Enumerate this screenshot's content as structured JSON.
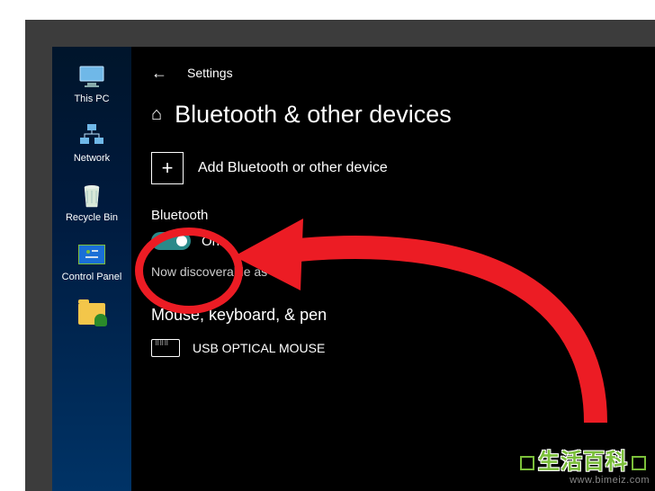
{
  "desktop": {
    "icons": [
      {
        "name": "this-pc",
        "label": "This PC"
      },
      {
        "name": "network",
        "label": "Network"
      },
      {
        "name": "recycle-bin",
        "label": "Recycle Bin"
      },
      {
        "name": "control-panel",
        "label": "Control Panel"
      },
      {
        "name": "user-folder",
        "label": ""
      }
    ]
  },
  "settings": {
    "back_label": "←",
    "app_title": "Settings",
    "home_glyph": "⌂",
    "page_title": "Bluetooth & other devices",
    "add_device": {
      "plus": "+",
      "label": "Add Bluetooth or other device"
    },
    "bluetooth": {
      "section_label": "Bluetooth",
      "state_label": "On",
      "state": true,
      "discoverable_prefix": "Now discoverable as"
    },
    "devices_section": {
      "heading": "Mouse, keyboard, & pen",
      "items": [
        {
          "icon": "keyboard",
          "name": "USB OPTICAL MOUSE"
        }
      ]
    }
  },
  "watermark": {
    "line1": "生活百科",
    "line2": "www.bimeiz.com"
  },
  "colors": {
    "toggle_on": "#2a8a8a",
    "annotation_red": "#ec1c24",
    "desktop_gradient_top": "#00152b",
    "desktop_gradient_bottom": "#003366"
  }
}
